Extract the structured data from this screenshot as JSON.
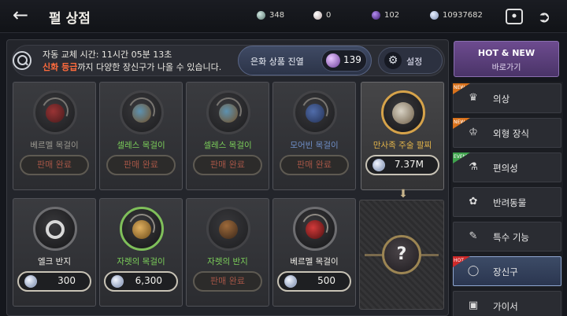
{
  "header": {
    "title": "펄 상점",
    "currencies": [
      {
        "name": "silver-coin",
        "value": "348"
      },
      {
        "name": "pearl",
        "value": "0"
      },
      {
        "name": "purple-gem",
        "value": "102"
      },
      {
        "name": "silver",
        "value": "10937682"
      }
    ]
  },
  "info": {
    "timer": "자동 교체 시간: 11시간 05분 13초",
    "desc_highlight": "신화 등급",
    "desc_rest": "까지 다양한 장신구가 나올 수 있습니다.",
    "silver_label": "은화 상품 진열",
    "silver_count": "139",
    "settings_label": "설정"
  },
  "items": [
    {
      "name": "베르멜 목걸이",
      "status": "판매 완료"
    },
    {
      "name": "셀레스 목걸이",
      "status": "판매 완료"
    },
    {
      "name": "셀레스 목걸이",
      "status": "판매 완료"
    },
    {
      "name": "모어빈 목걸이",
      "status": "판매 완료"
    },
    {
      "name": "만사족 주술 팔찌",
      "price": "7.37M"
    },
    {
      "name": "엘크 반지",
      "price": "300"
    },
    {
      "name": "자렛의 목걸이",
      "price": "6,300"
    },
    {
      "name": "자렛의 반지",
      "status": "판매 완료"
    },
    {
      "name": "베르멜 목걸이",
      "price": "500"
    }
  ],
  "mystery": {
    "symbol": "?"
  },
  "hotnew": {
    "title": "HOT & NEW",
    "sub": "바로가기"
  },
  "sidebar": [
    {
      "label": "의상",
      "icon": "armor-icon",
      "badge": "NEW"
    },
    {
      "label": "외형 장식",
      "icon": "crown-icon",
      "badge": "NEW"
    },
    {
      "label": "편의성",
      "icon": "potion-icon",
      "badge": "EVENT"
    },
    {
      "label": "반려동물",
      "icon": "paw-icon",
      "badge": ""
    },
    {
      "label": "특수 기능",
      "icon": "scroll-icon",
      "badge": ""
    },
    {
      "label": "장신구",
      "icon": "ring-icon",
      "badge": "HOT"
    },
    {
      "label": "가이서",
      "icon": "box-icon",
      "badge": ""
    }
  ],
  "colors": {
    "sold_text": "#a45546",
    "highlight": "#ff6b3d",
    "gold_name": "#e0b24a",
    "green_name": "#7cd05a",
    "grey_name": "#9a9890",
    "white_name": "#f0eee8"
  }
}
